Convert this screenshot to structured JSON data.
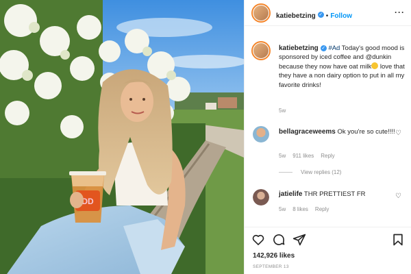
{
  "post": {
    "author": "katiebetzing",
    "follow_label": "Follow",
    "caption_tag": "#Ad",
    "caption_part1": " Today's good mood is sponsored by iced coffee and @dunkin because they now have oat milk",
    "caption_part2": " love that they have a non dairy option to put in all my favorite drinks!",
    "caption_age": "5w",
    "likes": "142,926 likes",
    "date": "SEPTEMBER 13"
  },
  "comments": [
    {
      "user": "bellagraceweems",
      "text": " Ok you're so cute!!!!",
      "age": "5w",
      "likes": "911 likes",
      "reply": "Reply"
    },
    {
      "user": "jatielife",
      "text": " THR PRETTIEST FR",
      "age": "5w",
      "likes": "8 likes",
      "reply": "Reply"
    }
  ],
  "view_replies": "View replies (12)",
  "cup_text": "DD",
  "colors": {
    "link": "#0095f6",
    "verified": "#3897f0",
    "text": "#262626",
    "muted": "#8e8e8e"
  },
  "icons": [
    "verified-icon",
    "more-icon",
    "heart-icon",
    "comment-icon",
    "share-icon",
    "bookmark-icon"
  ]
}
